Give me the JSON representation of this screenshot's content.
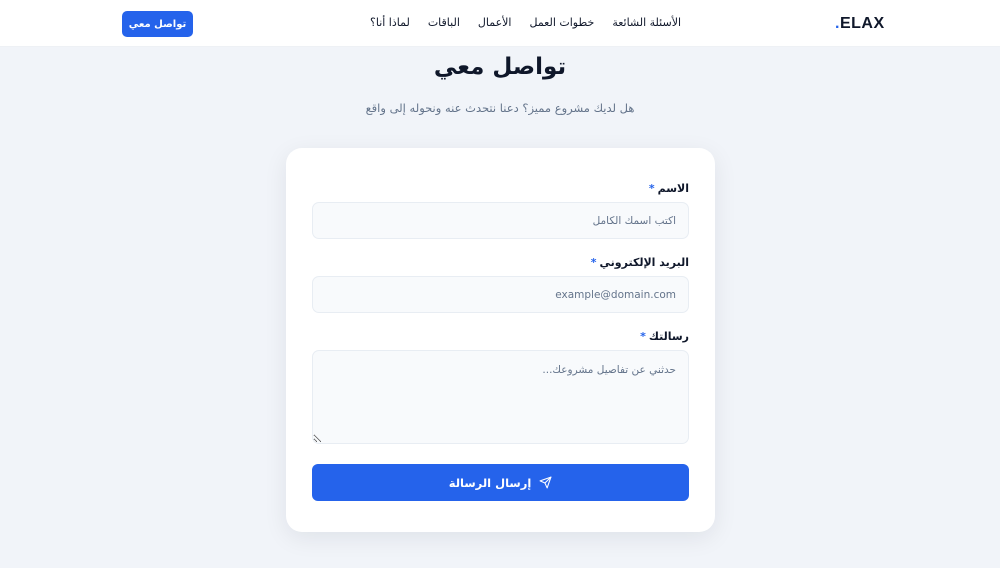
{
  "header": {
    "logo_text": "ELAX",
    "logo_dot": ".",
    "nav": [
      {
        "label": "لماذا أنا؟"
      },
      {
        "label": "الباقات"
      },
      {
        "label": "الأعمال"
      },
      {
        "label": "خطوات العمل"
      },
      {
        "label": "الأسئلة الشائعة"
      }
    ],
    "cta_label": "تواصل معي"
  },
  "hero": {
    "title": "تواصل معي",
    "subtitle": "هل لديك مشروع مميز؟ دعنا نتحدث عنه ونحوله إلى واقع"
  },
  "form": {
    "name": {
      "label": "الاسم",
      "required_mark": "*",
      "placeholder": "اكتب اسمك الكامل",
      "value": ""
    },
    "email": {
      "label": "البريد الإلكتروني",
      "required_mark": "*",
      "placeholder": "example@domain.com",
      "value": ""
    },
    "message": {
      "label": "رسالتك",
      "required_mark": "*",
      "placeholder": "حدثني عن تفاصيل مشروعك...",
      "value": ""
    },
    "submit_label": "إرسال الرسالة",
    "submit_icon": "send-icon"
  },
  "colors": {
    "accent": "#2563eb",
    "background": "#f1f4f9",
    "card": "#ffffff",
    "text": "#0f172a",
    "muted": "#64748b"
  }
}
